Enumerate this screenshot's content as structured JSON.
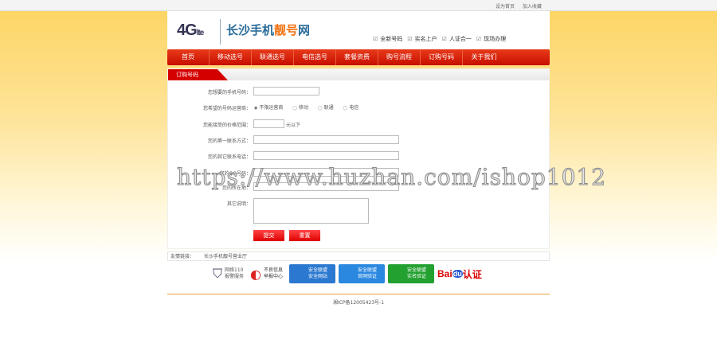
{
  "topbar": {
    "set_home": "设为首页",
    "add_fav": "加入收藏"
  },
  "header": {
    "logo": "4G",
    "logo_small": "lte",
    "site_name_a": "长沙手机",
    "site_name_b": "靓号",
    "site_name_c": "网",
    "features": [
      "全新号码",
      "实名上户",
      "人证合一",
      "现场办理"
    ]
  },
  "nav": [
    "首页",
    "移动选号",
    "联通选号",
    "电信选号",
    "套餐资费",
    "购号流程",
    "订购号码",
    "关于我们"
  ],
  "form": {
    "title": "订购号码",
    "labels": {
      "number": "您想要的手机号码：",
      "operator": "您希望的号码运营商：",
      "price": "您能接受的价格范围：",
      "contact1": "您的第一联系方式：",
      "contact2": "您的其它联系电话：",
      "qq": "您的QQ号码：",
      "location": "您的所在地：",
      "notes": "其它说明："
    },
    "operators": [
      "不限运营商",
      "移动",
      "联通",
      "电信"
    ],
    "price_suffix": "元以下",
    "submit": "提交",
    "reset": "重置"
  },
  "links": {
    "label": "友情链接：",
    "items": [
      "长沙手机靓号营业厅"
    ]
  },
  "badges": {
    "police_a": "网络110",
    "police_b": "报警服务",
    "report_a": "不良信息",
    "report_b": "举报中心",
    "sec1_a": "安全联盟",
    "sec1_b": "安全网站",
    "sec2_a": "安全联盟",
    "sec2_b": "官网验证",
    "sec3_a": "安全联盟",
    "sec3_b": "实名验证",
    "baidu": "Bai",
    "baidu_du": "du",
    "baidu_cert": "认证"
  },
  "footer": {
    "icp": "湘ICP备12005423号-1"
  },
  "watermark": "https://www.huzhan.com/ishop1012"
}
